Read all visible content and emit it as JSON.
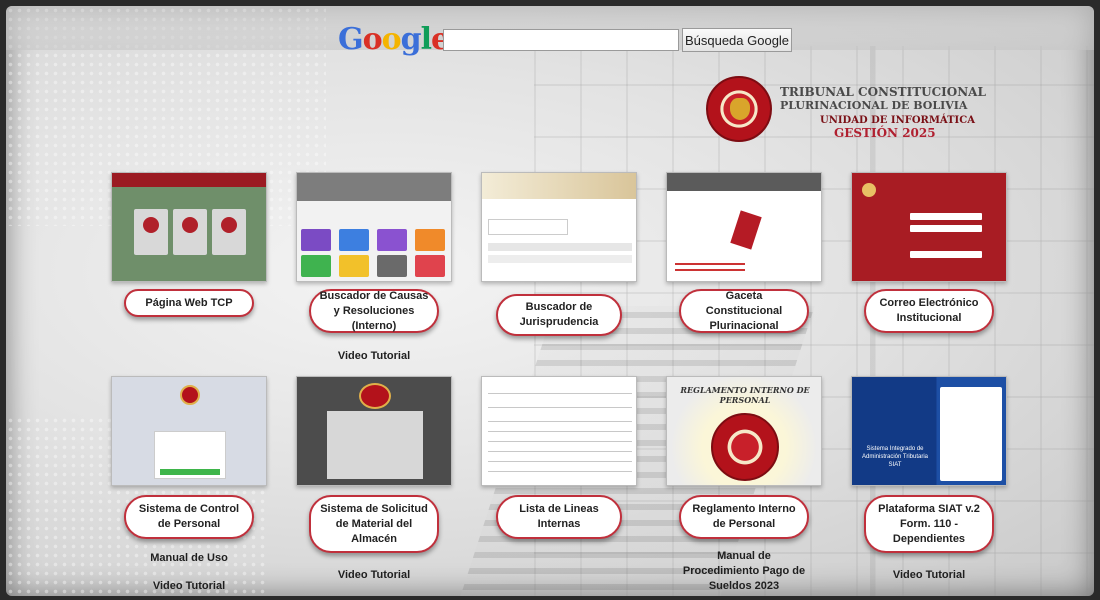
{
  "search": {
    "logo_letters": [
      "G",
      "o",
      "o",
      "g",
      "l",
      "e"
    ],
    "input_value": "",
    "button_label": "Búsqueda Google"
  },
  "institution": {
    "line1": "TRIBUNAL CONSTITUCIONAL",
    "line2": "PLURINACIONAL DE BOLIVIA",
    "line3": "UNIDAD DE INFORMÁTICA",
    "line4": "GESTIÓN 2025"
  },
  "cards": [
    {
      "label": "Página Web TCP",
      "links": []
    },
    {
      "label": "Buscador de Causas y Resoluciones (Interno)",
      "links": [
        "Video Tutorial"
      ]
    },
    {
      "label": "Buscador de Jurisprudencia",
      "links": []
    },
    {
      "label": "Gaceta Constitucional Plurinacional",
      "links": []
    },
    {
      "label": "Correo Electrónico Institucional",
      "links": []
    },
    {
      "label": "Sistema de Control de Personal",
      "links": [
        "Manual de Uso",
        "Video Tutorial"
      ]
    },
    {
      "label": "Sistema de Solicitud de Material del Almacén",
      "links": [
        "Video Tutorial"
      ]
    },
    {
      "label": "Lista de Lineas Internas",
      "links": []
    },
    {
      "label": "Reglamento Interno de Personal",
      "links": [
        "Manual de Procedimiento Pago de Sueldos 2023"
      ]
    },
    {
      "label": "Plataforma SIAT v.2 Form. 110 - Dependientes",
      "links": [
        "Video Tutorial"
      ]
    }
  ],
  "thumbs": {
    "reglamento_title": "REGLAMENTO INTERNO DE PERSONAL",
    "siat_text": "Sistema Integrado de Administración Tributaria SIAT"
  },
  "colors": {
    "accent_red": "#c0303c",
    "tcp_red": "#a81c23",
    "siat_blue": "#123a86"
  }
}
